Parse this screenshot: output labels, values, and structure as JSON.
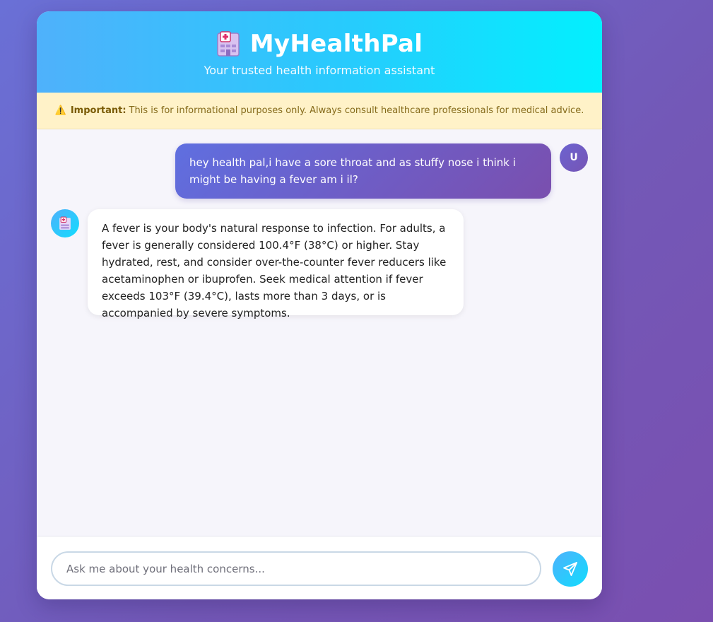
{
  "header": {
    "logo_icon": "hospital-icon",
    "title": "MyHealthPal",
    "subtitle": "Your trusted health information assistant"
  },
  "disclaimer": {
    "icon": "warning-icon",
    "label": "Important:",
    "text": "This is for informational purposes only. Always consult healthcare professionals for medical advice."
  },
  "messages": [
    {
      "sender": "user",
      "avatar": "U",
      "text": "hey health pal,i have a sore throat and as stuffy nose i think i might be having a fever am i il?"
    },
    {
      "sender": "bot",
      "avatar_icon": "hospital-icon",
      "text": "A fever is your body's natural response to infection. For adults, a fever is generally considered 100.4°F (38°C) or higher. Stay hydrated, rest, and consider over-the-counter fever reducers like acetaminophen or ibuprofen. Seek medical attention if fever exceeds 103°F (39.4°C), lasts more than 3 days, or is accompanied by severe symptoms."
    }
  ],
  "input": {
    "placeholder": "Ask me about your health concerns...",
    "value": ""
  },
  "send_button": {
    "icon": "send-icon"
  },
  "colors": {
    "header_start": "#4fb1fb",
    "header_end": "#02f0fe",
    "user_bubble_start": "#5f6fe0",
    "user_bubble_end": "#7a4fae",
    "disclaimer_bg": "#fff2c8",
    "page_bg": "#6a70d6"
  }
}
